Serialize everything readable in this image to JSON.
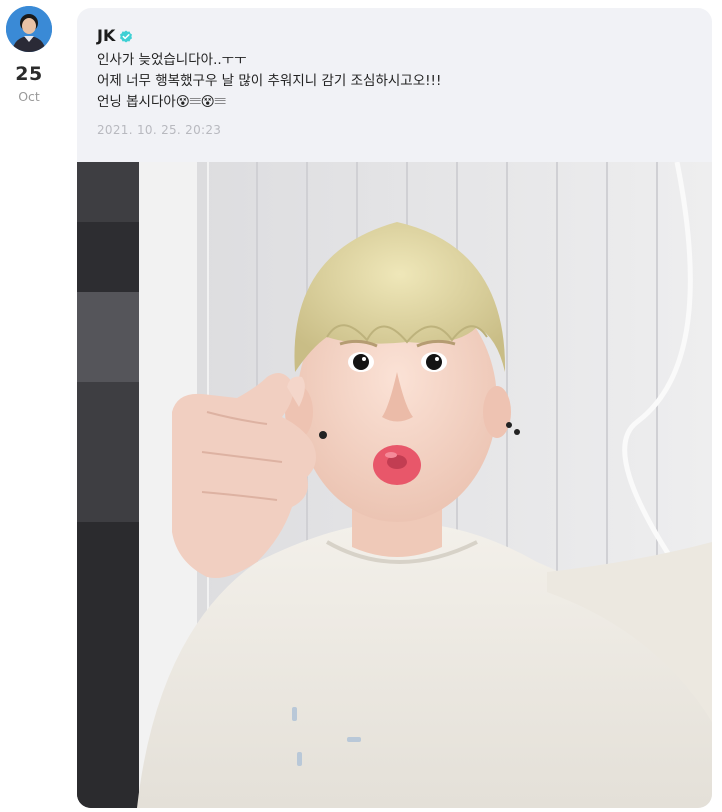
{
  "date": {
    "day": "25",
    "month": "Oct"
  },
  "post": {
    "author": "JK",
    "lines": [
      "인사가 늦었습니다아..ㅜㅜ",
      "어제 너무 행복했구우 날 많이 추워지니 감기 조심하시고오!!!",
      "언닝 봅시다아😵𝄘😵𝄘"
    ],
    "timestamp": "2021. 10. 25. 20:23"
  },
  "icons": {
    "verified": "verified-badge-icon",
    "avatar": "profile-avatar"
  },
  "colors": {
    "card_bg": "#f1f2f6",
    "verified": "#3fd0d4",
    "timestamp": "#b8b9bf",
    "muted": "#9a9a9a"
  }
}
